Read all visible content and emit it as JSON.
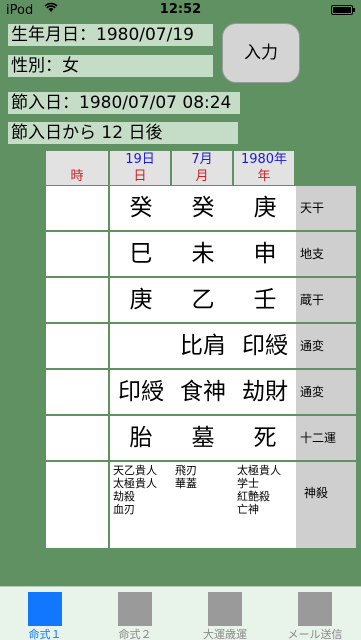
{
  "status": {
    "carrier": "iPod",
    "time": "12:52",
    "wifi_icon": "wifi-icon",
    "battery_icon": "battery-icon"
  },
  "form": {
    "birthdate": "生年月日：1980/07/19",
    "gender": "性別：女",
    "input_button": "入力",
    "setsuiri_date": "節入日：1980/07/07 08:24",
    "days_after": "節入日から 12 日後"
  },
  "table": {
    "header_values": [
      "19日",
      "7月",
      "1980年"
    ],
    "header_labels": [
      "時",
      "日",
      "月",
      "年"
    ],
    "rows": [
      {
        "label": "天干",
        "cells": [
          "",
          "癸",
          "癸",
          "庚"
        ]
      },
      {
        "label": "地支",
        "cells": [
          "",
          "巳",
          "未",
          "申"
        ]
      },
      {
        "label": "蔵干",
        "cells": [
          "",
          "庚",
          "乙",
          "壬"
        ]
      },
      {
        "label": "通変",
        "cells": [
          "",
          "",
          "比肩",
          "印綬"
        ]
      },
      {
        "label": "通変",
        "cells": [
          "",
          "印綬",
          "食神",
          "劫財"
        ]
      },
      {
        "label": "十二運",
        "cells": [
          "",
          "胎",
          "墓",
          "死"
        ]
      }
    ],
    "shinsatsu_label": "神殺",
    "shinsatsu": [
      "",
      "天乙貴人\n太極貴人\n劫殺\n血刃",
      "飛刃\n華蓋",
      "太極貴人\n学士\n紅艶殺\n亡神"
    ]
  },
  "tabs": [
    {
      "label": "命式１",
      "active": true
    },
    {
      "label": "命式２",
      "active": false
    },
    {
      "label": "大運歳運",
      "active": false
    },
    {
      "label": "メール送信",
      "active": false
    }
  ]
}
